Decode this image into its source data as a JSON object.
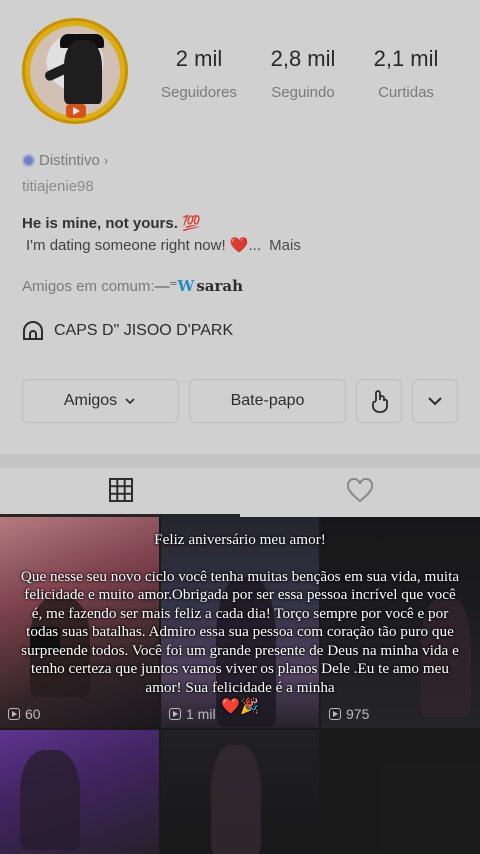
{
  "profile": {
    "username": "titiajenie98",
    "badge_label": "Distintivo",
    "stats": [
      {
        "value": "2 mil",
        "label": "Seguidores"
      },
      {
        "value": "2,8 mil",
        "label": "Seguindo"
      },
      {
        "value": "2,1 mil",
        "label": "Curtidas"
      }
    ],
    "bio_line1": "He is mine, not yours. 💯",
    "bio_line2": "I'm dating someone right now! ❤️...",
    "bio_more": "Mais",
    "friends_label": "Amigos em comum:",
    "friends_name": "sarah",
    "location": "CAPS D\" JISOO D'PARK"
  },
  "actions": {
    "friends_button": "Amigos",
    "chat_button": "Bate-papo"
  },
  "videos": [
    {
      "views": "60"
    },
    {
      "views": "1 mil"
    },
    {
      "views": "975"
    }
  ],
  "overlay_message": "Feliz aniversário meu amor!\n\nQue nesse seu novo ciclo você tenha muitas bençãos em sua vida, muita felicidade e muito amor.Obrigada por ser essa pessoa incrível que você é, me fazendo ser mais feliz a cada dia! Torço sempre por você e por todas suas batalhas.  Admiro essa sua pessoa com coração tão puro que surpreende todos. Você foi um grande presente de Deus na minha vida e tenho certeza que juntos vamos viver os planos Dele .Eu te amo meu amor! Sua felicidade é a minha",
  "overlay_emojis": "❤️🎉",
  "colors": {
    "profile_bg": "#e8e8e8",
    "grid_bg": "#1e1e1f",
    "avatar_ring": "#f4c21a",
    "badge": "#7c8fdc"
  }
}
